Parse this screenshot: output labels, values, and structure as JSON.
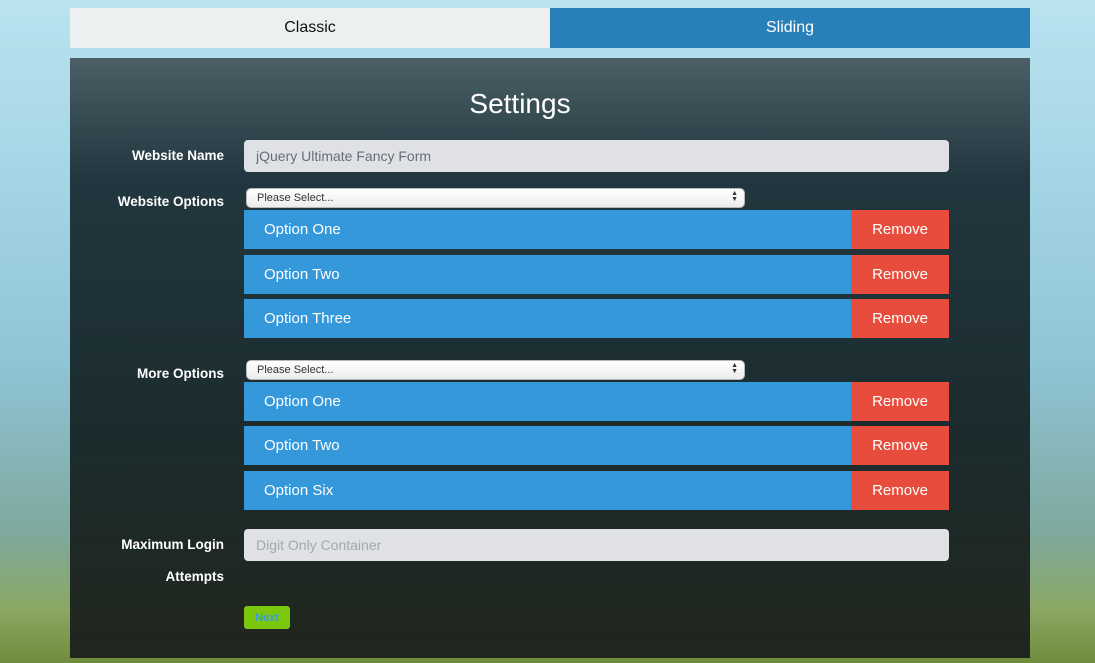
{
  "tabs": {
    "classic": "Classic",
    "sliding": "Sliding"
  },
  "form": {
    "title": "Settings",
    "website_name": {
      "label": "Website Name",
      "value": "jQuery Ultimate Fancy Form"
    },
    "website_options": {
      "label": "Website Options",
      "select_value": "Please Select...",
      "items": [
        "Option One",
        "Option Two",
        "Option Three"
      ]
    },
    "more_options": {
      "label": "More Options",
      "select_value": "Please Select...",
      "items": [
        "Option One",
        "Option Two",
        "Option Six"
      ]
    },
    "max_login": {
      "label_line1": "Maximum Login",
      "label_line2": "Attempts",
      "placeholder": "Digit Only Container"
    },
    "remove_label": "Remove",
    "next_label": "Next"
  },
  "colors": {
    "tab_active": "#2980b9",
    "option_blue": "#3498db",
    "remove_red": "#e74c3c",
    "next_green": "#7ac70b"
  }
}
